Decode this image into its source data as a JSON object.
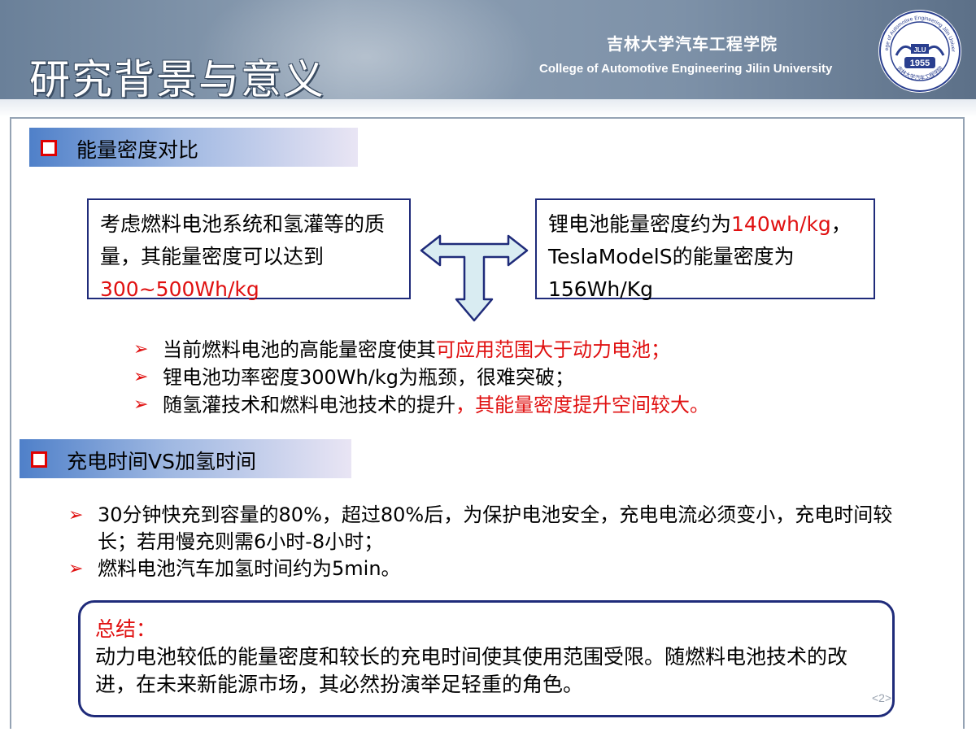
{
  "header": {
    "title": "研究背景与意义",
    "college_cn": "吉林大学汽车工程学院",
    "college_en": "College of Automotive Engineering Jilin University",
    "logo": {
      "ring_text": "College of Automotive Engineering Jilin University",
      "bottom_text": "吉林大学汽车工程学院",
      "center_text": "JLU",
      "year": "1955"
    }
  },
  "section1": {
    "label": "能量密度对比",
    "left_box": {
      "text_a": "考虑燃料电池系统和氢灌等的质量，其能量密度可以达到",
      "text_red": "300~500Wh/kg"
    },
    "right_box": {
      "text_a": "锂电池能量密度约为",
      "text_red": "140wh/kg",
      "text_b": "，TeslaModelS的能量密度为156Wh/Kg"
    },
    "bullets": [
      {
        "text": "当前燃料电池的高能量密度使其",
        "red": "可应用范围大于动力电池；"
      },
      {
        "text": "锂电池功率密度300Wh/kg为瓶颈，很难突破；",
        "red": ""
      },
      {
        "text": "随氢灌技术和燃料电池技术的提升",
        "red": "，其能量密度提升空间较大。"
      }
    ]
  },
  "section2": {
    "label": "充电时间VS加氢时间",
    "bullets": [
      {
        "text": "30分钟快充到容量的80%，超过80%后，为保护电池安全，充电电流必须变小，充电时间较长；若用慢充则需6小时-8小时；"
      },
      {
        "text": "燃料电池汽车加氢时间约为5min。"
      }
    ]
  },
  "summary": {
    "label": "总结：",
    "text": "动力电池较低的能量密度和较长的充电时间使其使用范围受限。随燃料电池技术的改进，在未来新能源市场，其必然扮演举足轻重的角色。"
  },
  "page_number": "<2>",
  "icons": {
    "bullet": "arrow-bullet-icon",
    "section_marker": "checkbox-icon",
    "diagram": "three-way-arrow-icon"
  },
  "colors": {
    "accent_red": "#e01010",
    "border_navy": "#1f2b7a",
    "header_blue": "#7d91a8",
    "arrow_fill": "#d9ecf2"
  }
}
